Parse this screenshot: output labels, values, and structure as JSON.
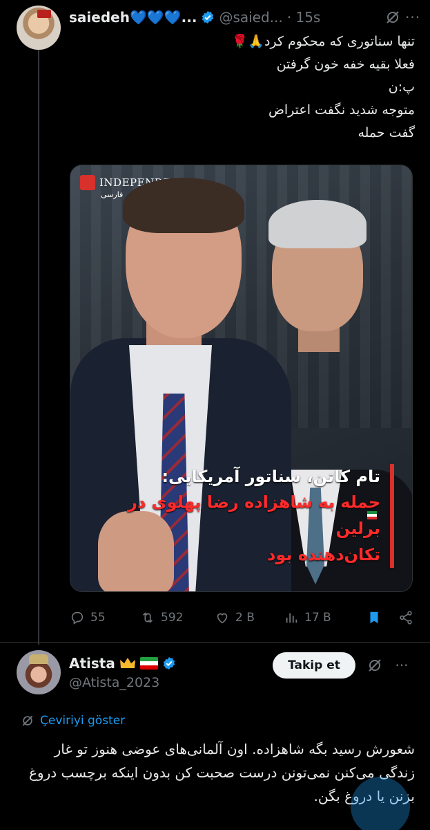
{
  "tweet1": {
    "author_name": "saiedeh💙💙💙...",
    "handle": "@saied...",
    "time": "· 15s",
    "lines": [
      "تنها سناتوری که محکوم کرد🙏🌹",
      "فعلا بقیه خفه خون گرفتن",
      "پ:ن",
      "متوجه شدید نگفت اعتراض",
      "گفت حمله"
    ],
    "media": {
      "logo_text": "INDEPENDENT",
      "logo_sub": "فارسی",
      "caption_line1": "تام کاتن، سناتور آمریکایی:",
      "caption_line2": "حمله به شاهزاده رضا پهلوی در برلین",
      "caption_line3": "تکان‌دهنده بود"
    },
    "stats": {
      "replies": "55",
      "reposts": "592",
      "likes": "2 B",
      "views": "17 B"
    }
  },
  "tweet2": {
    "author_name": "Atista",
    "handle": "@Atista_2023",
    "follow_label": "Takip et",
    "translate_label": "Çeviriyi göster",
    "text": "شعورش رسید بگه شاهزاده. اون آلمانی‌های عوضی هنوز تو غار زندگی می‌کنن نمی‌تونن درست صحبت کن بدون اینکه برچسب دروغ بزنن یا دروغ بگن."
  },
  "colors": {
    "background": "#000000",
    "accent": "#1d9bf0",
    "muted": "#71767b",
    "text": "#e7e9ea",
    "caption_red": "#ff2a2a"
  },
  "icons": [
    "verified-icon",
    "grok-icon",
    "more-icon",
    "reply-icon",
    "repost-icon",
    "like-icon",
    "views-icon",
    "bookmark-icon",
    "share-icon",
    "translate-icon"
  ]
}
